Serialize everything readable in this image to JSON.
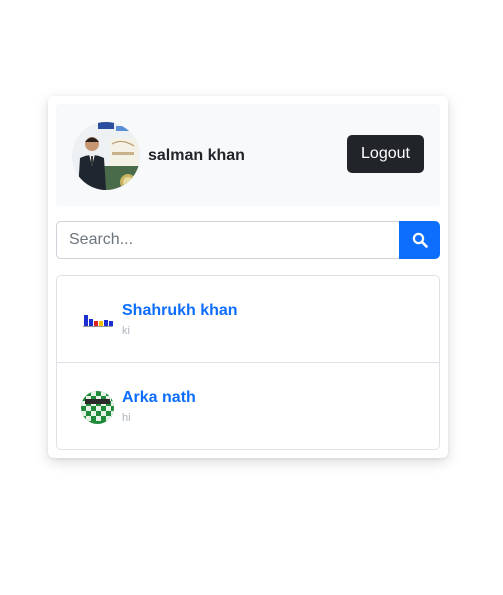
{
  "user": {
    "name": "salman khan",
    "avatar_icon": "profile-photo"
  },
  "header": {
    "logout_label": "Logout"
  },
  "search": {
    "placeholder": "Search...",
    "button_icon": "search-icon"
  },
  "contacts": [
    {
      "name": "Shahrukh khan",
      "last_message": "ki",
      "avatar_icon": "bar-chart-avatar"
    },
    {
      "name": "Arka nath",
      "last_message": "hi",
      "avatar_icon": "chess-board-avatar"
    }
  ],
  "colors": {
    "primary": "#0d6efd",
    "dark": "#212529",
    "header_bg": "#f8f9fa",
    "muted": "#adb5bd"
  }
}
